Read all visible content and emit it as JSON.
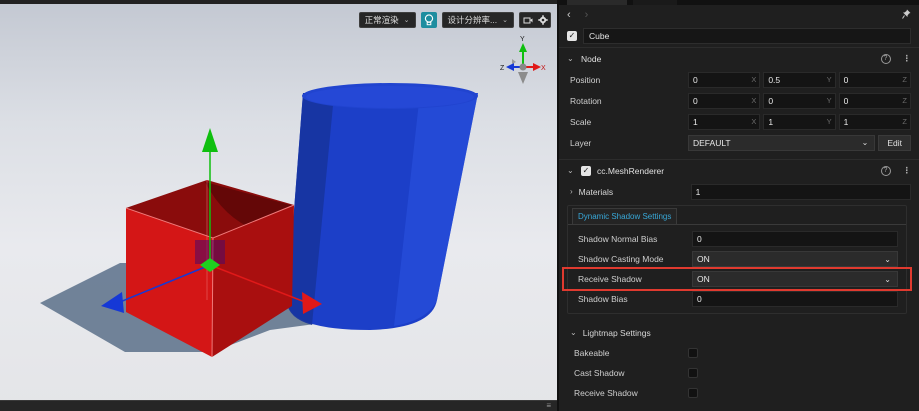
{
  "scene": {
    "toolbar": {
      "render_mode": "正常渲染",
      "design_resolution": "设计分辨率..."
    },
    "gizmo_axes": {
      "y": "Y",
      "x": "X",
      "z": "Z"
    },
    "colors": {
      "cube_red": "#d11414",
      "cylinder_blue": "#1c3fc8",
      "axis_green": "#0fbf0f",
      "axis_red": "#e01919",
      "axis_blue": "#1538d6",
      "shadow": "#5b7089"
    }
  },
  "inspector": {
    "node_name": "Cube",
    "node_section": {
      "title": "Node",
      "position": {
        "label": "Position",
        "x": "0",
        "y": "0.5",
        "z": "0"
      },
      "rotation": {
        "label": "Rotation",
        "x": "0",
        "y": "0",
        "z": "0"
      },
      "scale": {
        "label": "Scale",
        "x": "1",
        "y": "1",
        "z": "1"
      },
      "layer": {
        "label": "Layer",
        "value": "DEFAULT",
        "edit": "Edit"
      }
    },
    "mesh_renderer": {
      "title": "cc.MeshRenderer",
      "materials": {
        "label": "Materials",
        "value": "1"
      },
      "shadow_group": {
        "tab": "Dynamic Shadow Settings",
        "normal_bias": {
          "label": "Shadow Normal Bias",
          "value": "0"
        },
        "casting_mode": {
          "label": "Shadow Casting Mode",
          "value": "ON"
        },
        "receive_shadow": {
          "label": "Receive Shadow",
          "value": "ON"
        },
        "shadow_bias": {
          "label": "Shadow Bias",
          "value": "0"
        }
      },
      "lightmap": {
        "title": "Lightmap Settings",
        "bakeable": "Bakeable",
        "cast_shadow": "Cast Shadow",
        "receive_shadow": "Receive Shadow"
      }
    },
    "axis_letters": {
      "x": "X",
      "y": "Y",
      "z": "Z"
    },
    "help_glyph": "?"
  }
}
